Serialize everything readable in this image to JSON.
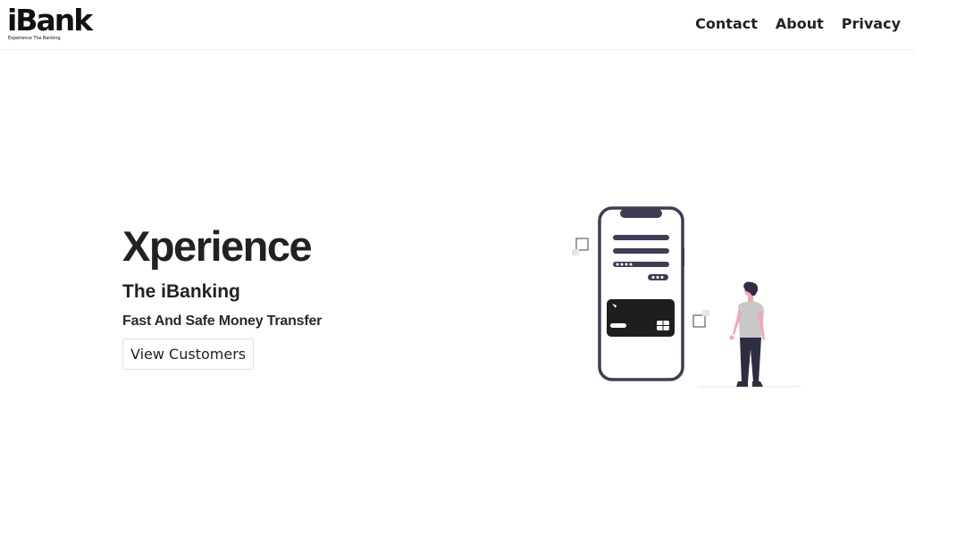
{
  "brand": {
    "name": "iBank",
    "tagline": "Experience The Banking"
  },
  "nav": {
    "links": [
      "Contact",
      "About",
      "Privacy"
    ]
  },
  "hero": {
    "title": "Xperience",
    "subtitle": "The iBanking",
    "tagline": "Fast And Safe Money Transfer",
    "button_label": "View Customers"
  },
  "colors": {
    "phone": "#3f3d56",
    "card": "#1e1e1e",
    "accent": "#f8a5b1",
    "shirt": "#c8c8c8"
  }
}
